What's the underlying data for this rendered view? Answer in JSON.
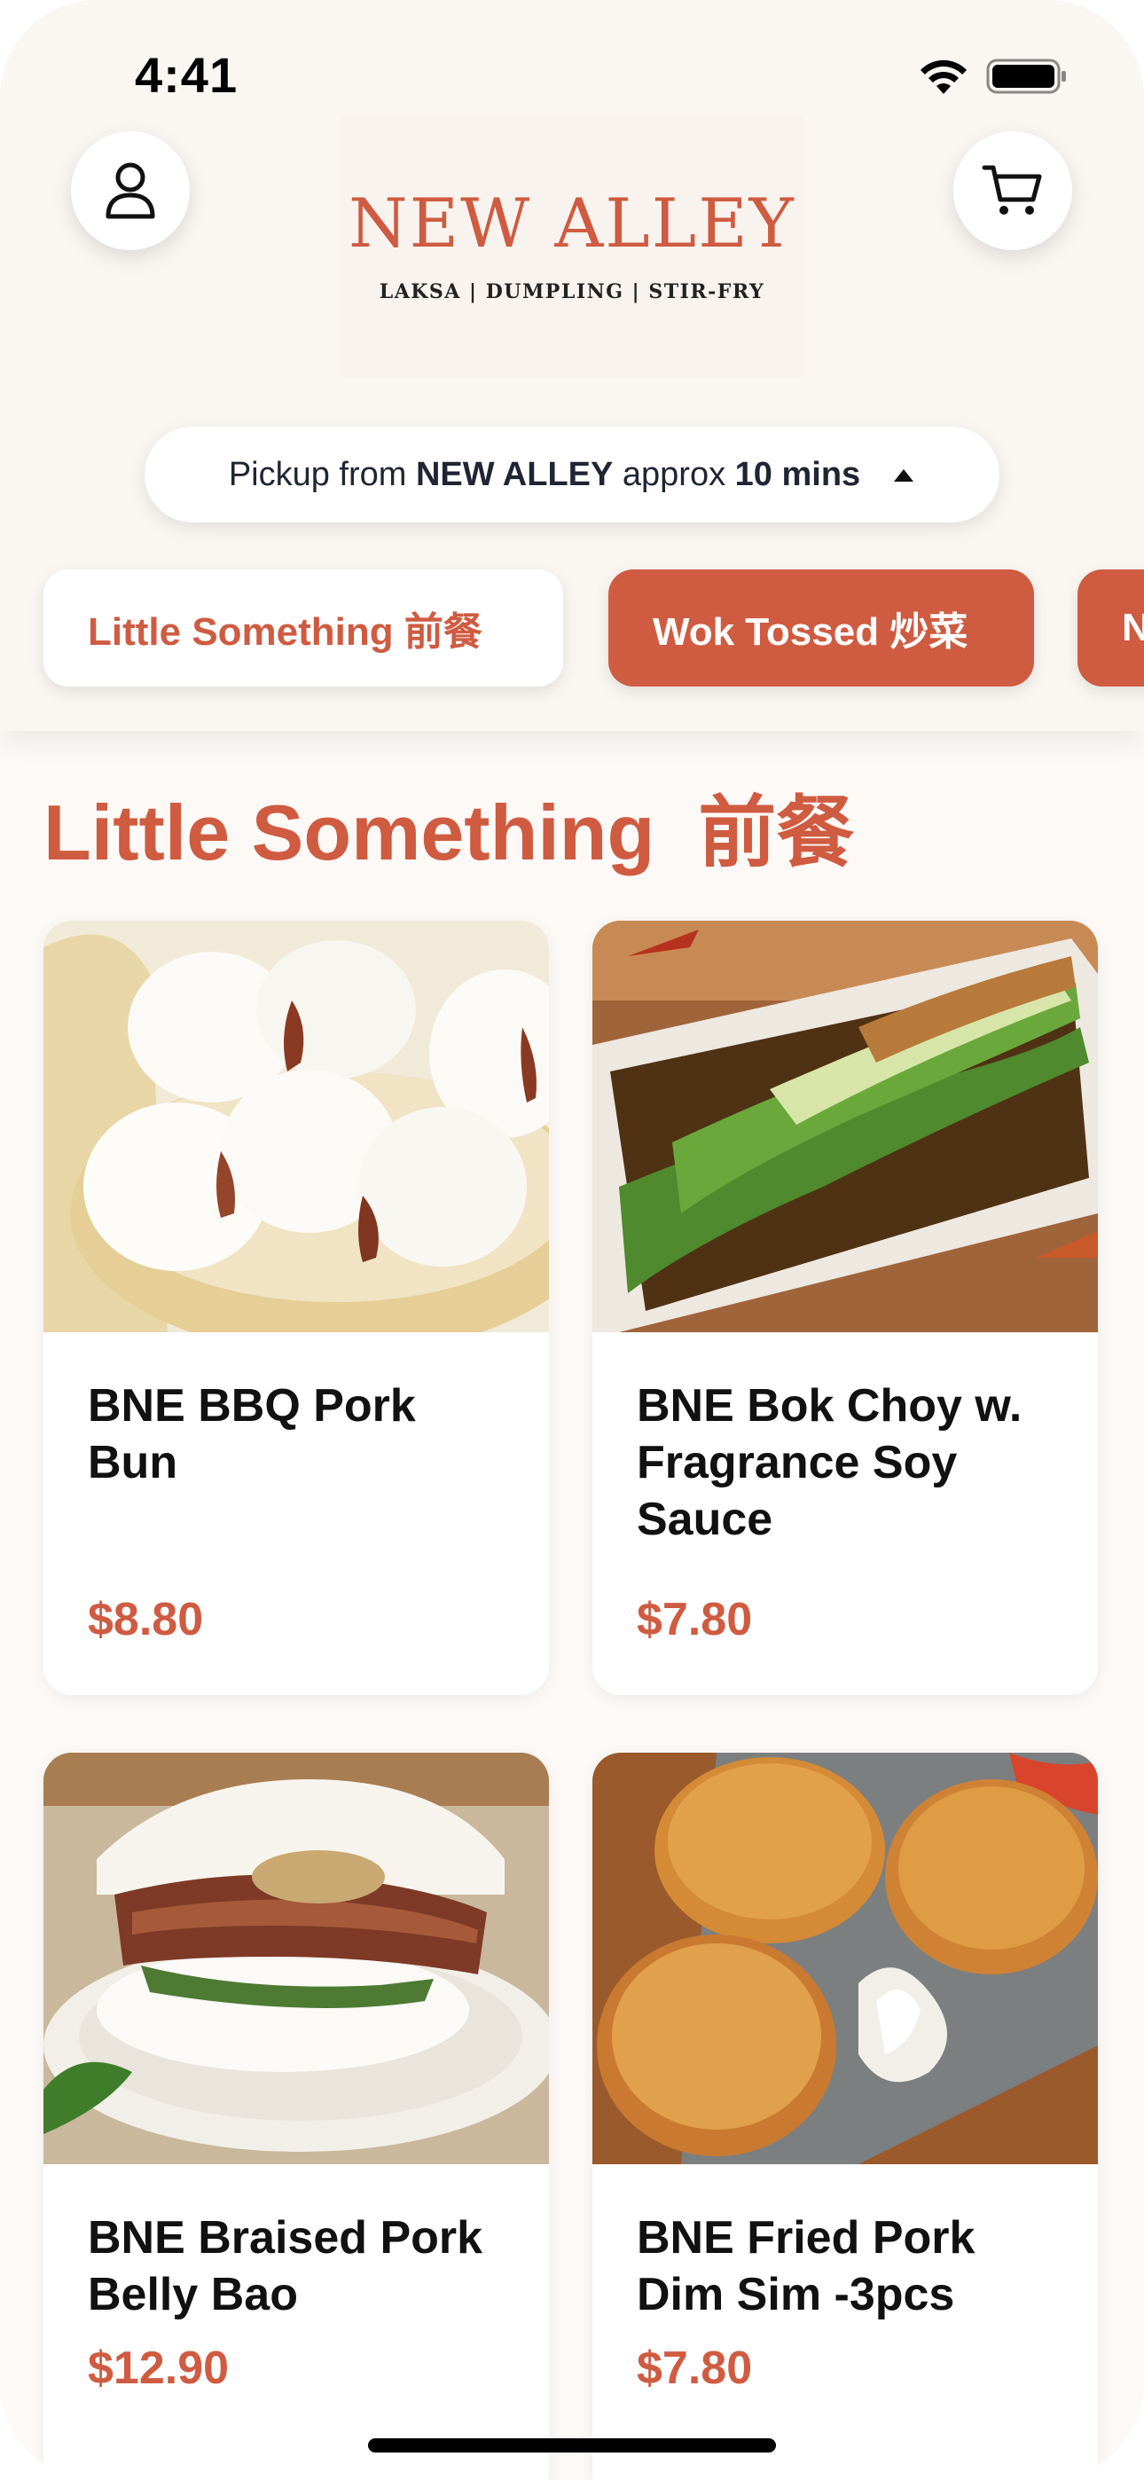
{
  "status_bar": {
    "time": "4:41"
  },
  "header": {
    "profile_icon": "person-icon",
    "cart_icon": "cart-icon",
    "logo": {
      "name": "NEW ALLEY",
      "tagline": "LAKSA | DUMPLING | STIR-FRY"
    }
  },
  "pickup": {
    "prefix": "Pickup from ",
    "store": "NEW ALLEY",
    "middle": " approx ",
    "time": "10 mins",
    "icon": "caret-up-icon"
  },
  "categories": [
    {
      "label": "Little Something  前餐",
      "selected": true
    },
    {
      "label": "Wok Tossed 炒菜",
      "selected": false
    },
    {
      "label": "N",
      "selected": false
    }
  ],
  "section": {
    "title": "Little Something  前餐"
  },
  "menu_items": [
    {
      "name": "BNE BBQ Pork Bun",
      "price": "$8.80",
      "image": "steamed-pork-buns-photo"
    },
    {
      "name": "BNE Bok Choy w. Fragrance Soy Sauce",
      "price": "$7.80",
      "image": "bok-choy-photo"
    },
    {
      "name": "BNE Braised Pork Belly Bao",
      "price": "$12.90",
      "image": "pork-belly-bao-photo"
    },
    {
      "name": "BNE Fried Pork Dim Sim -3pcs",
      "price": "$7.80",
      "image": "fried-dim-sim-photo"
    }
  ],
  "colors": {
    "accent": "#cf5b41",
    "background": "#fcf9f6",
    "text": "#111111"
  }
}
